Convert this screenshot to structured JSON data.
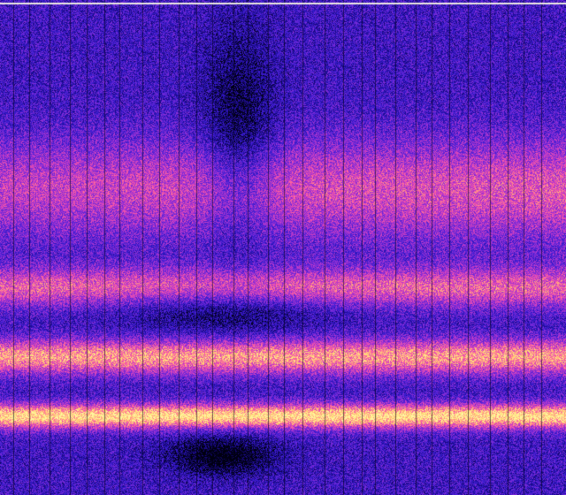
{
  "image": {
    "kind": "spectrogram",
    "colormap": [
      "#000010",
      "#1a0a8c",
      "#3a1cd0",
      "#7a2ad8",
      "#c23ac8",
      "#ff5ea0",
      "#ffd070",
      "#fff8a0"
    ],
    "background_color": "#2a1090",
    "bands": [
      {
        "name": "upper-broad",
        "center_frac": 0.38,
        "width_frac": 0.1,
        "intensity": 0.45
      },
      {
        "name": "mid-band",
        "center_frac": 0.58,
        "width_frac": 0.04,
        "intensity": 0.6
      },
      {
        "name": "strong-band",
        "center_frac": 0.72,
        "width_frac": 0.035,
        "intensity": 0.8
      },
      {
        "name": "brightest-band",
        "center_frac": 0.84,
        "width_frac": 0.025,
        "intensity": 1.0
      }
    ],
    "vertical_line_count": 30,
    "has_top_white_line": true
  }
}
